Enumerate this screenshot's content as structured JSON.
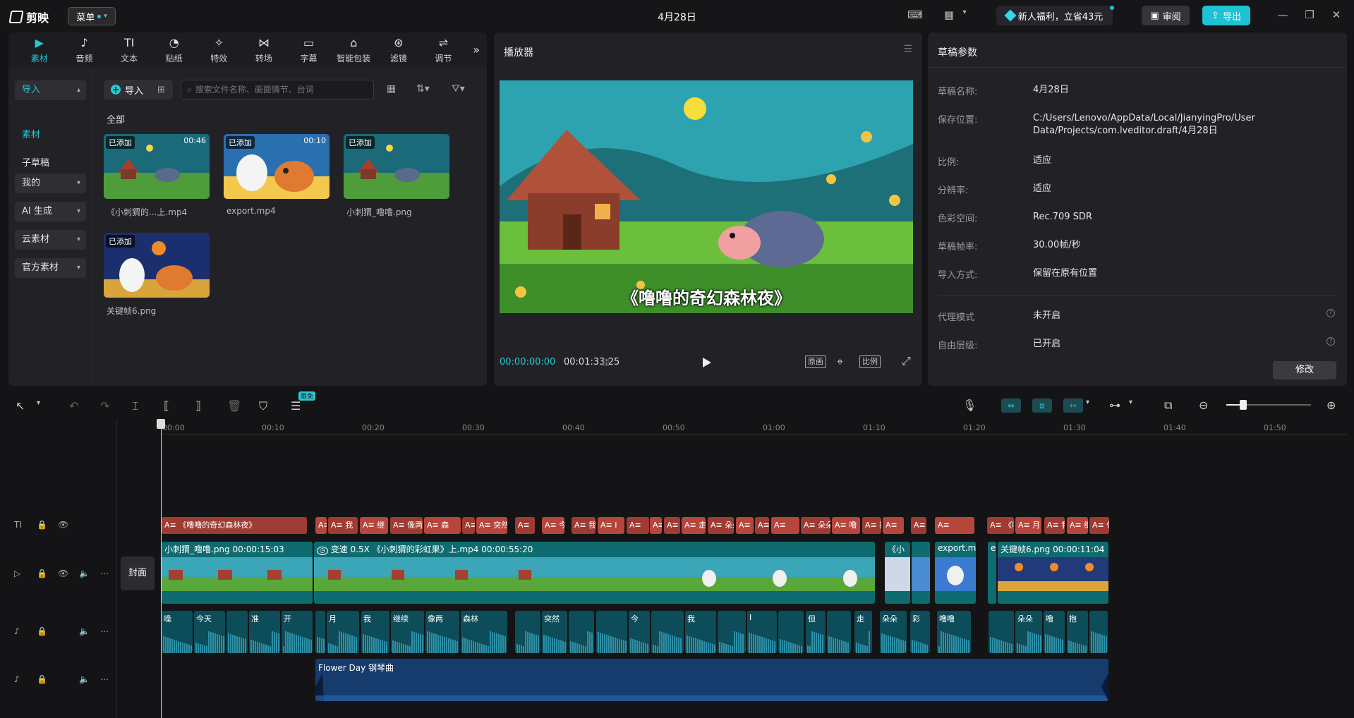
{
  "app": {
    "logo": "剪映",
    "menu_label": "菜单",
    "title": "4月28日",
    "promo": "新人福利，立省43元",
    "review": "审阅",
    "export": "导出"
  },
  "media": {
    "tabs": [
      {
        "label": "素材",
        "icon": "media-icon"
      },
      {
        "label": "音频",
        "icon": "audio-icon"
      },
      {
        "label": "文本",
        "icon": "text-icon"
      },
      {
        "label": "贴纸",
        "icon": "sticker-icon"
      },
      {
        "label": "特效",
        "icon": "effects-icon"
      },
      {
        "label": "转场",
        "icon": "transition-icon"
      },
      {
        "label": "字幕",
        "icon": "caption-icon"
      },
      {
        "label": "智能包装",
        "icon": "smart-pack-icon"
      },
      {
        "label": "滤镜",
        "icon": "filter-icon"
      },
      {
        "label": "调节",
        "icon": "adjust-icon"
      }
    ],
    "sidebar": [
      "导入",
      "素材",
      "子草稿",
      "我的",
      "AI 生成",
      "云素材",
      "官方素材"
    ],
    "import_label": "导入",
    "search_placeholder": "搜索文件名称、画面情节、台词",
    "all_label": "全部",
    "items": [
      {
        "name": "《小刺猬的...上.mp4",
        "badge": "已添加",
        "duration": "00:46"
      },
      {
        "name": "export.mp4",
        "badge": "已添加",
        "duration": "00:10"
      },
      {
        "name": "小刺猬_噜噜.png",
        "badge": "已添加",
        "duration": ""
      },
      {
        "name": "关键帧6.png",
        "badge": "已添加",
        "duration": ""
      }
    ]
  },
  "player": {
    "title": "播放器",
    "subtitle": "《噜噜的奇幻森林夜》",
    "current_time": "00:00:00:00",
    "total_time": "00:01:33:25",
    "btn_original": "原画",
    "btn_ratio": "比例"
  },
  "draft": {
    "title": "草稿参数",
    "rows": [
      {
        "label": "草稿名称:",
        "value": "4月28日"
      },
      {
        "label": "保存位置:",
        "value": "C:/Users/Lenovo/AppData/Local/JianyingPro/User Data/Projects/com.lveditor.draft/4月28日"
      },
      {
        "label": "比例:",
        "value": "适应"
      },
      {
        "label": "分辨率:",
        "value": "适应"
      },
      {
        "label": "色彩空间:",
        "value": "Rec.709 SDR"
      },
      {
        "label": "草稿帧率:",
        "value": "30.00帧/秒"
      },
      {
        "label": "导入方式:",
        "value": "保留在原有位置"
      },
      {
        "label": "代理模式",
        "value": "未开启"
      },
      {
        "label": "自由层级:",
        "value": "已开启"
      }
    ],
    "modify": "修改"
  },
  "timeline": {
    "limited_badge": "限免",
    "ruler": [
      "00:00",
      "00:10",
      "00:20",
      "00:30",
      "00:40",
      "00:50",
      "01:00",
      "01:10",
      "01:20",
      "01:30",
      "01:40",
      "01:50"
    ],
    "cover_label": "封面",
    "text_clips": [
      "《噜噜的奇幻森林夜》",
      "月",
      "我",
      "继",
      "像两",
      "森",
      "I",
      "突然",
      "",
      "今",
      "我",
      "I",
      "",
      "但",
      "",
      "走",
      "朵朵",
      "彩",
      "噜噜",
      "",
      "朵朵",
      "噜",
      "抱",
      "",
      "带",
      ""
    ],
    "video_clips": [
      {
        "name": "小刺猬_噜噜.png",
        "duration": "00:00:15:03"
      },
      {
        "name": "变速 0.5X 《小刺猬的彩虹果》上.mp4",
        "duration": "00:00:55:20"
      },
      {
        "name": "《小",
        "duration": ""
      },
      {
        "name": "export.m",
        "duration": ""
      },
      {
        "name": "e",
        "duration": ""
      },
      {
        "name": "关键帧6.png",
        "duration": "00:00:11:04"
      }
    ],
    "audio_clips": [
      "噪",
      "今天",
      "",
      "准",
      "开",
      "",
      "月",
      "我",
      "继续",
      "像两",
      "森林",
      "",
      "突然",
      "",
      "",
      "今",
      "",
      "我",
      "",
      "I",
      "",
      "但",
      "",
      "走",
      "朵朵",
      "彩",
      "噜噜",
      "",
      "朵朵",
      "噜",
      "抱",
      "",
      "带",
      ""
    ],
    "music_label": "Flower Day 钢琴曲"
  }
}
